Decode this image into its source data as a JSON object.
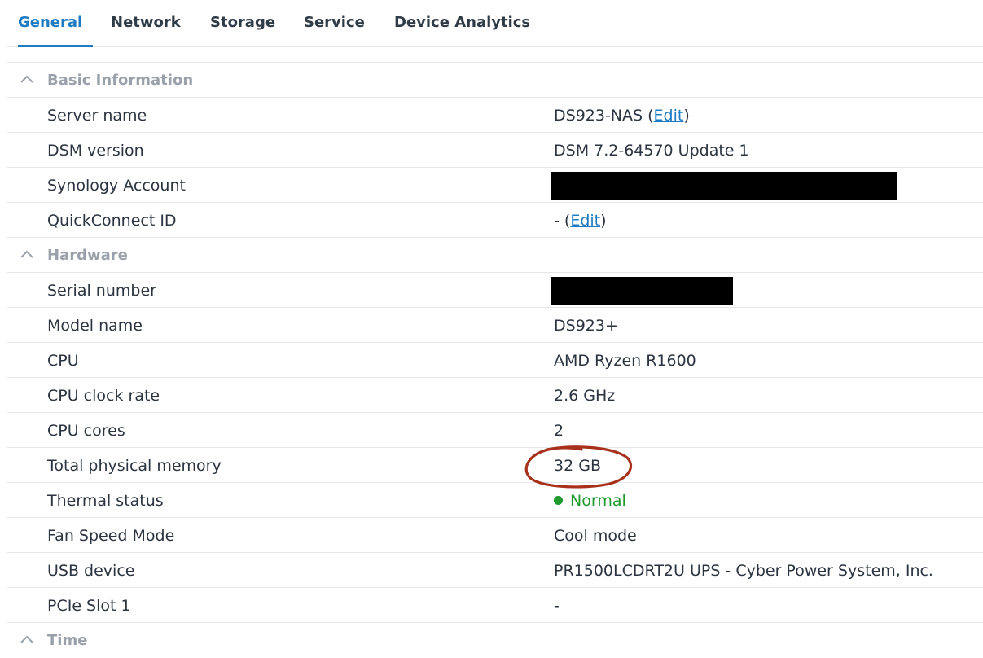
{
  "tabs": [
    {
      "label": "General",
      "active": true
    },
    {
      "label": "Network"
    },
    {
      "label": "Storage"
    },
    {
      "label": "Service"
    },
    {
      "label": "Device Analytics"
    }
  ],
  "basic": {
    "title": "Basic Information",
    "server_name": {
      "label": "Server name",
      "value": "DS923-NAS",
      "edit_label": "Edit"
    },
    "dsm_version": {
      "label": "DSM version",
      "value": "DSM 7.2-64570 Update 1"
    },
    "synology_account": {
      "label": "Synology Account",
      "value_redacted": true
    },
    "quickconnect": {
      "label": "QuickConnect ID",
      "value": "-",
      "edit_label": "Edit"
    }
  },
  "hardware": {
    "title": "Hardware",
    "serial": {
      "label": "Serial number",
      "value_redacted": true
    },
    "model": {
      "label": "Model name",
      "value": "DS923+"
    },
    "cpu": {
      "label": "CPU",
      "value": "AMD Ryzen R1600"
    },
    "clock": {
      "label": "CPU clock rate",
      "value": "2.6 GHz"
    },
    "cores": {
      "label": "CPU cores",
      "value": "2"
    },
    "memory": {
      "label": "Total physical memory",
      "value": "32 GB",
      "annotated": true
    },
    "thermal": {
      "label": "Thermal status",
      "value": "Normal",
      "status_color": "#1f9b2e"
    },
    "fan": {
      "label": "Fan Speed Mode",
      "value": "Cool mode"
    },
    "usb": {
      "label": "USB device",
      "value": "PR1500LCDRT2U UPS - Cyber Power System, Inc."
    },
    "pcie": {
      "label": "PCIe Slot 1",
      "value": "-"
    }
  },
  "time": {
    "title": "Time"
  },
  "colors": {
    "accent": "#1d7bc3",
    "annotation": "#a8311b",
    "status_ok": "#1f9b2e"
  },
  "icons": {
    "section_toggle": "chevron-up-icon"
  }
}
